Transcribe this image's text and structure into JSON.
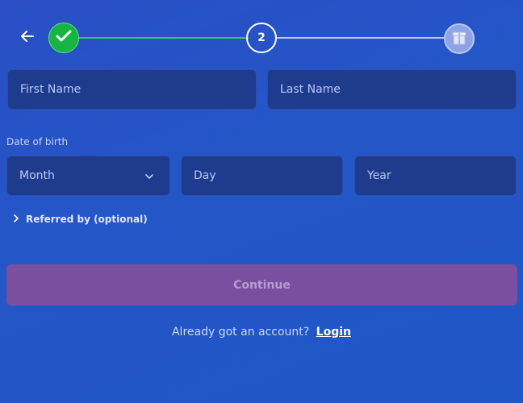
{
  "stepper": {
    "back_icon": "back-arrow-icon",
    "step1_icon": "checkmark-icon",
    "step2_label": "2",
    "step3_icon": "gift-icon",
    "colors": {
      "done": "#16b443",
      "line_done": "#35c95a",
      "line_todo": "#cfd9ff"
    }
  },
  "form": {
    "first_name_placeholder": "First Name",
    "last_name_placeholder": "Last Name",
    "dob_label": "Date of birth",
    "month_placeholder": "Month",
    "day_placeholder": "Day",
    "year_placeholder": "Year",
    "referred_label": "Referred by (optional)"
  },
  "actions": {
    "continue_label": "Continue"
  },
  "footer": {
    "prompt": "Already got an account?",
    "login_label": "Login"
  },
  "colors": {
    "background": "#2456c8",
    "field_bg": "#1f3b8e",
    "continue_bg": "#7a4fa0"
  }
}
